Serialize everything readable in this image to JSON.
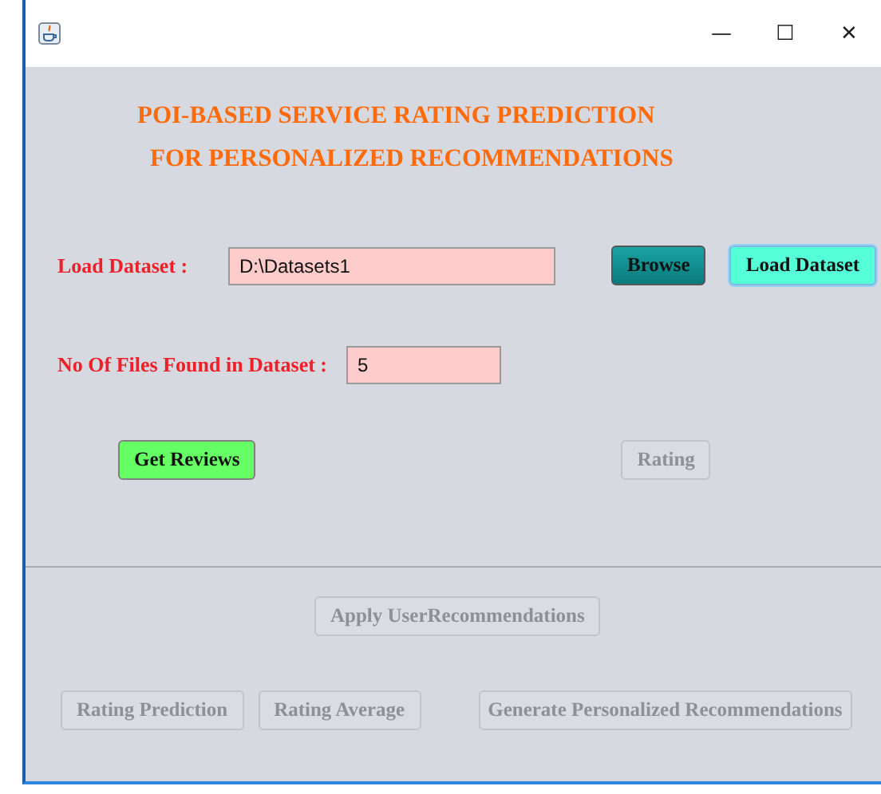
{
  "window": {
    "controls": [
      "—",
      "☐",
      "✕"
    ]
  },
  "heading": [
    "POI-BASED SERVICE RATING PREDICTION",
    "FOR PERSONALIZED RECOMMENDATIONS"
  ],
  "dataset_row": {
    "label": "Load Dataset :",
    "value": "D:\\Datasets1",
    "buttons": [
      {
        "label": "Browse",
        "kind": "teal",
        "disabled": false
      },
      {
        "label": "Load Dataset",
        "kind": "aqua",
        "disabled": false
      }
    ]
  },
  "files_row": {
    "label": "No Of Files Found in Dataset :",
    "value": "5"
  },
  "review_row": [
    {
      "label": "Get Reviews",
      "kind": "green",
      "disabled": false
    },
    {
      "label": "Rating",
      "disabled": true
    }
  ],
  "apply_button": {
    "label": "Apply UserRecommendations",
    "disabled": true
  },
  "bottom_row": [
    {
      "label": "Rating Prediction",
      "disabled": true
    },
    {
      "label": "Rating Average",
      "disabled": true
    },
    {
      "label": "Generate Personalized Recommendations",
      "disabled": true
    }
  ]
}
